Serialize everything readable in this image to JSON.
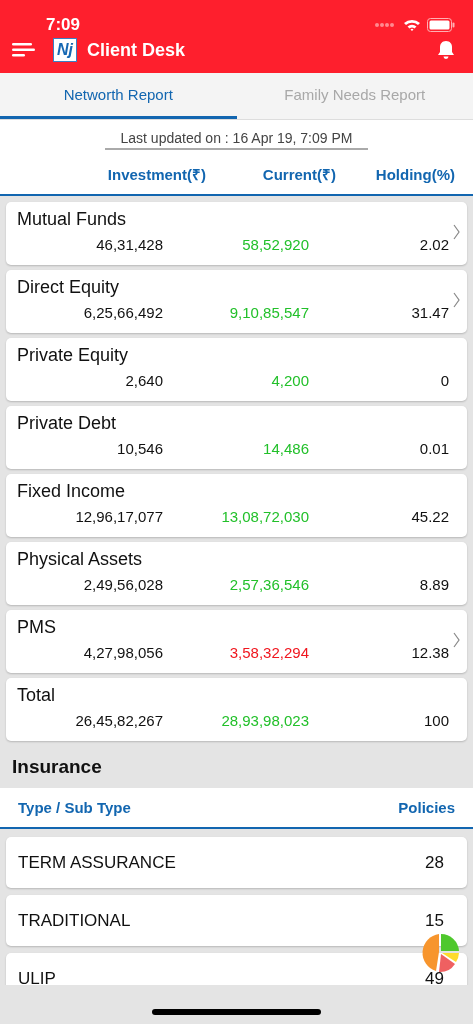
{
  "status_bar": {
    "time": "7:09"
  },
  "header": {
    "logo": "Nj",
    "title": "Client Desk"
  },
  "tabs": [
    {
      "label": "Networth Report",
      "selected": true
    },
    {
      "label": "Family Needs Report",
      "selected": false
    }
  ],
  "last_updated": "Last updated on : 16 Apr 19, 7:09 PM",
  "networth": {
    "columns": [
      "Investment(₹)",
      "Current(₹)",
      "Holding(%)"
    ],
    "rows": [
      {
        "name": "Mutual Funds",
        "investment": "46,31,428",
        "current": "58,52,920",
        "color": "#22c02a",
        "holding": "2.02",
        "has_details": true
      },
      {
        "name": "Direct Equity",
        "investment": "6,25,66,492",
        "current": "9,10,85,547",
        "color": "#22c02a",
        "holding": "31.47",
        "has_details": true
      },
      {
        "name": "Private Equity",
        "investment": "2,640",
        "current": "4,200",
        "color": "#22c02a",
        "holding": "0",
        "has_details": false
      },
      {
        "name": "Private Debt",
        "investment": "10,546",
        "current": "14,486",
        "color": "#22c02a",
        "holding": "0.01",
        "has_details": false
      },
      {
        "name": "Fixed Income",
        "investment": "12,96,17,077",
        "current": "13,08,72,030",
        "color": "#22c02a",
        "holding": "45.22",
        "has_details": false
      },
      {
        "name": "Physical Assets",
        "investment": "2,49,56,028",
        "current": "2,57,36,546",
        "color": "#22c02a",
        "holding": "8.89",
        "has_details": false
      },
      {
        "name": "PMS",
        "investment": "4,27,98,056",
        "current": "3,58,32,294",
        "color": "#f0161e",
        "holding": "12.38",
        "has_details": true
      },
      {
        "name": "Total",
        "investment": "26,45,82,267",
        "current": "28,93,98,023",
        "color": "#22c02a",
        "holding": "100",
        "has_details": false
      }
    ]
  },
  "insurance": {
    "title": "Insurance",
    "columns": [
      "Type / Sub Type",
      "Policies"
    ],
    "rows": [
      {
        "type": "TERM ASSURANCE",
        "policies": "28"
      },
      {
        "type": "TRADITIONAL",
        "policies": "15"
      },
      {
        "type": "ULIP",
        "policies": "49"
      }
    ]
  }
}
